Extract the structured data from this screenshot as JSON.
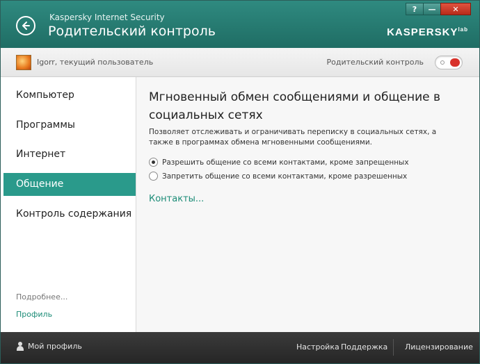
{
  "titlebar": {
    "app_name": "Kaspersky Internet Security",
    "page_heading": "Родительский контроль",
    "logo_text": "KASPERSKY",
    "logo_mark": "lab",
    "help_label": "?",
    "minimize_label": "—",
    "close_label": "✕"
  },
  "userbar": {
    "user_label": "Igorr, текущий пользователь",
    "parental_control_label": "Родительский контроль",
    "parental_control_enabled": false
  },
  "sidebar": {
    "items": [
      {
        "label": "Компьютер"
      },
      {
        "label": "Программы"
      },
      {
        "label": "Интернет"
      },
      {
        "label": "Общение"
      },
      {
        "label": "Контроль содержания"
      }
    ],
    "active_index": 3,
    "more_label": "Подробнее...",
    "profile_label": "Профиль"
  },
  "main": {
    "title": "Мгновенный обмен сообщениями и общение в социальных сетях",
    "description": "Позволяет отслеживать и ограничивать переписку в социальных сетях, а также в программах обмена мгновенными сообщениями.",
    "options": [
      {
        "label": "Разрешить общение со всеми контактами, кроме запрещенных",
        "checked": true
      },
      {
        "label": "Запретить общение со всеми контактами, кроме разрешенных",
        "checked": false
      }
    ],
    "contacts_link": "Контакты..."
  },
  "bottombar": {
    "my_profile": "Мой профиль",
    "settings": "Настройка",
    "support": "Поддержка",
    "licensing": "Лицензирование"
  },
  "colors": {
    "accent": "#2a9a8b",
    "titlebar": "#1f6d64",
    "link": "#1c8c77",
    "bottombar": "#2b2b2b"
  }
}
